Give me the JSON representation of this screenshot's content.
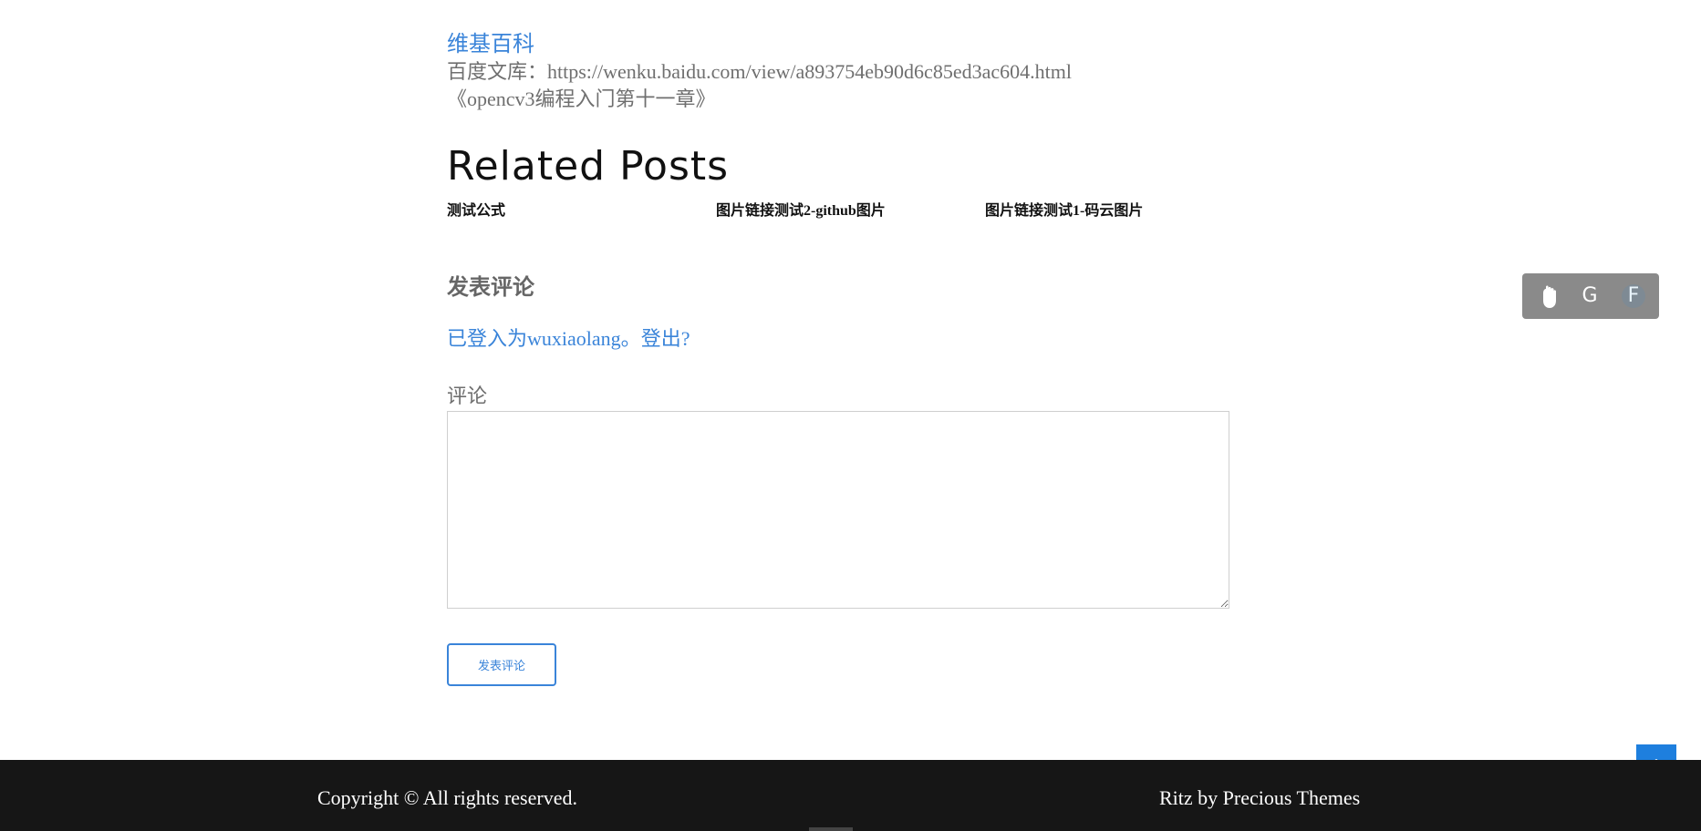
{
  "references": {
    "wiki_link": "维基百科",
    "baidu_line": "百度文库：https://wenku.baidu.com/view/a893754eb90d6c85ed3ac604.html",
    "book_line": "《opencv3编程入门第十一章》"
  },
  "related": {
    "title": "Related Posts",
    "items": [
      "测试公式",
      "图片链接测试2-github图片",
      "图片链接测试1-码云图片"
    ]
  },
  "comment": {
    "heading": "发表评论",
    "logged_in_prefix": "已登入为",
    "username": "wuxiaolang",
    "separator": "。",
    "logout": "登出?",
    "field_label": "评论",
    "textarea_value": "",
    "submit_label": "发表评论"
  },
  "share_widget": {
    "icons": [
      "hand-icon",
      "google-icon",
      "facebook-icon"
    ],
    "google_letter": "G",
    "facebook_letter": "F"
  },
  "scroll_top": {
    "icon": "chevron-up-icon",
    "color": "#1e7fde"
  },
  "footer": {
    "copyright": "Copyright © All rights reserved.",
    "credit": "Ritz by Precious Themes"
  },
  "colors": {
    "link": "#3a84d9",
    "footer_bg": "#161616",
    "share_bg": "#8a8a8a"
  }
}
